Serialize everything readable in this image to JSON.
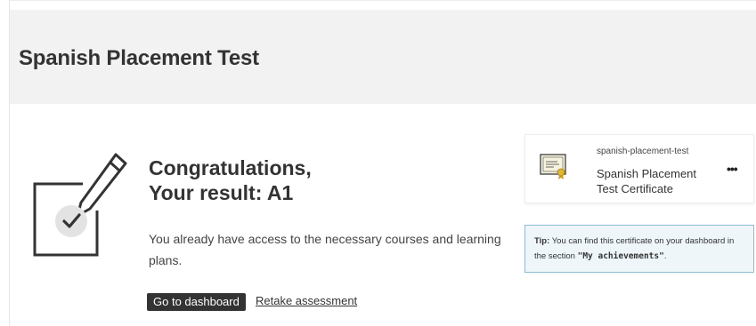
{
  "header": {
    "title": "Spanish Placement Test"
  },
  "result": {
    "line1": "Congratulations,",
    "line2": "Your result: A1",
    "description": "You already have access to the necessary courses and learning plans."
  },
  "actions": {
    "primary_label": "Go to dashboard",
    "secondary_label": "Retake assessment"
  },
  "certificate": {
    "slug": "spanish-placement-test",
    "name": "Spanish Placement Test Certificate",
    "menu_label": "•••"
  },
  "tip": {
    "prefix": "Tip:",
    "text": " You can find this certificate on your dashboard in the section ",
    "section": "\"My achievements\"",
    "suffix": "."
  },
  "icons": {
    "main": "certificate-edit-icon",
    "card": "certificate-icon"
  },
  "colors": {
    "header_bg": "#f2f2f2",
    "button_bg": "#333333",
    "tip_bg": "#eef6fa",
    "tip_border": "#8cbdd3"
  }
}
